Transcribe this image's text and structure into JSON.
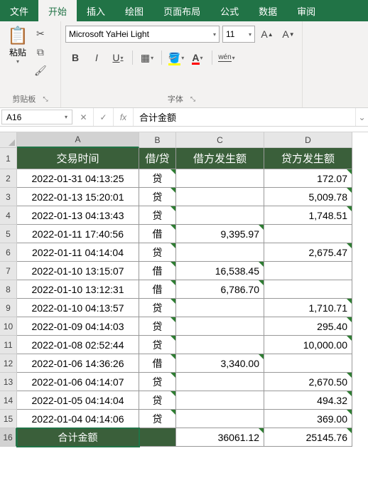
{
  "tabs": {
    "file": "文件",
    "home": "开始",
    "insert": "插入",
    "draw": "绘图",
    "layout": "页面布局",
    "formulas": "公式",
    "data": "数据",
    "review": "审阅"
  },
  "ribbon": {
    "clipboard": {
      "paste": "粘贴",
      "label": "剪贴板"
    },
    "font": {
      "name": "Microsoft YaHei Light",
      "size": "11",
      "label": "字体",
      "bold": "B",
      "italic": "I",
      "underline": "U",
      "wen": "wén"
    }
  },
  "namebox": "A16",
  "formula_value": "合计金额",
  "colheads": {
    "A": "A",
    "B": "B",
    "C": "C",
    "D": "D"
  },
  "headers": {
    "time": "交易时间",
    "dc": "借/贷",
    "debit": "借方发生额",
    "credit": "贷方发生额"
  },
  "rows": [
    {
      "r": "2",
      "t": "2022-01-31 04:13:25",
      "dc": "贷",
      "d": "",
      "c": "172.07"
    },
    {
      "r": "3",
      "t": "2022-01-13 15:20:01",
      "dc": "贷",
      "d": "",
      "c": "5,009.78"
    },
    {
      "r": "4",
      "t": "2022-01-13 04:13:43",
      "dc": "贷",
      "d": "",
      "c": "1,748.51"
    },
    {
      "r": "5",
      "t": "2022-01-11 17:40:56",
      "dc": "借",
      "d": "9,395.97",
      "c": ""
    },
    {
      "r": "6",
      "t": "2022-01-11 04:14:04",
      "dc": "贷",
      "d": "",
      "c": "2,675.47"
    },
    {
      "r": "7",
      "t": "2022-01-10 13:15:07",
      "dc": "借",
      "d": "16,538.45",
      "c": ""
    },
    {
      "r": "8",
      "t": "2022-01-10 13:12:31",
      "dc": "借",
      "d": "6,786.70",
      "c": ""
    },
    {
      "r": "9",
      "t": "2022-01-10 04:13:57",
      "dc": "贷",
      "d": "",
      "c": "1,710.71"
    },
    {
      "r": "10",
      "t": "2022-01-09 04:14:03",
      "dc": "贷",
      "d": "",
      "c": "295.40"
    },
    {
      "r": "11",
      "t": "2022-01-08 02:52:44",
      "dc": "贷",
      "d": "",
      "c": "10,000.00"
    },
    {
      "r": "12",
      "t": "2022-01-06 14:36:26",
      "dc": "借",
      "d": "3,340.00",
      "c": ""
    },
    {
      "r": "13",
      "t": "2022-01-06 04:14:07",
      "dc": "贷",
      "d": "",
      "c": "2,670.50"
    },
    {
      "r": "14",
      "t": "2022-01-05 04:14:04",
      "dc": "贷",
      "d": "",
      "c": "494.32"
    },
    {
      "r": "15",
      "t": "2022-01-04 04:14:06",
      "dc": "贷",
      "d": "",
      "c": "369.00"
    }
  ],
  "total": {
    "r": "16",
    "label": "合计金额",
    "debit": "36061.12",
    "credit": "25145.76"
  }
}
